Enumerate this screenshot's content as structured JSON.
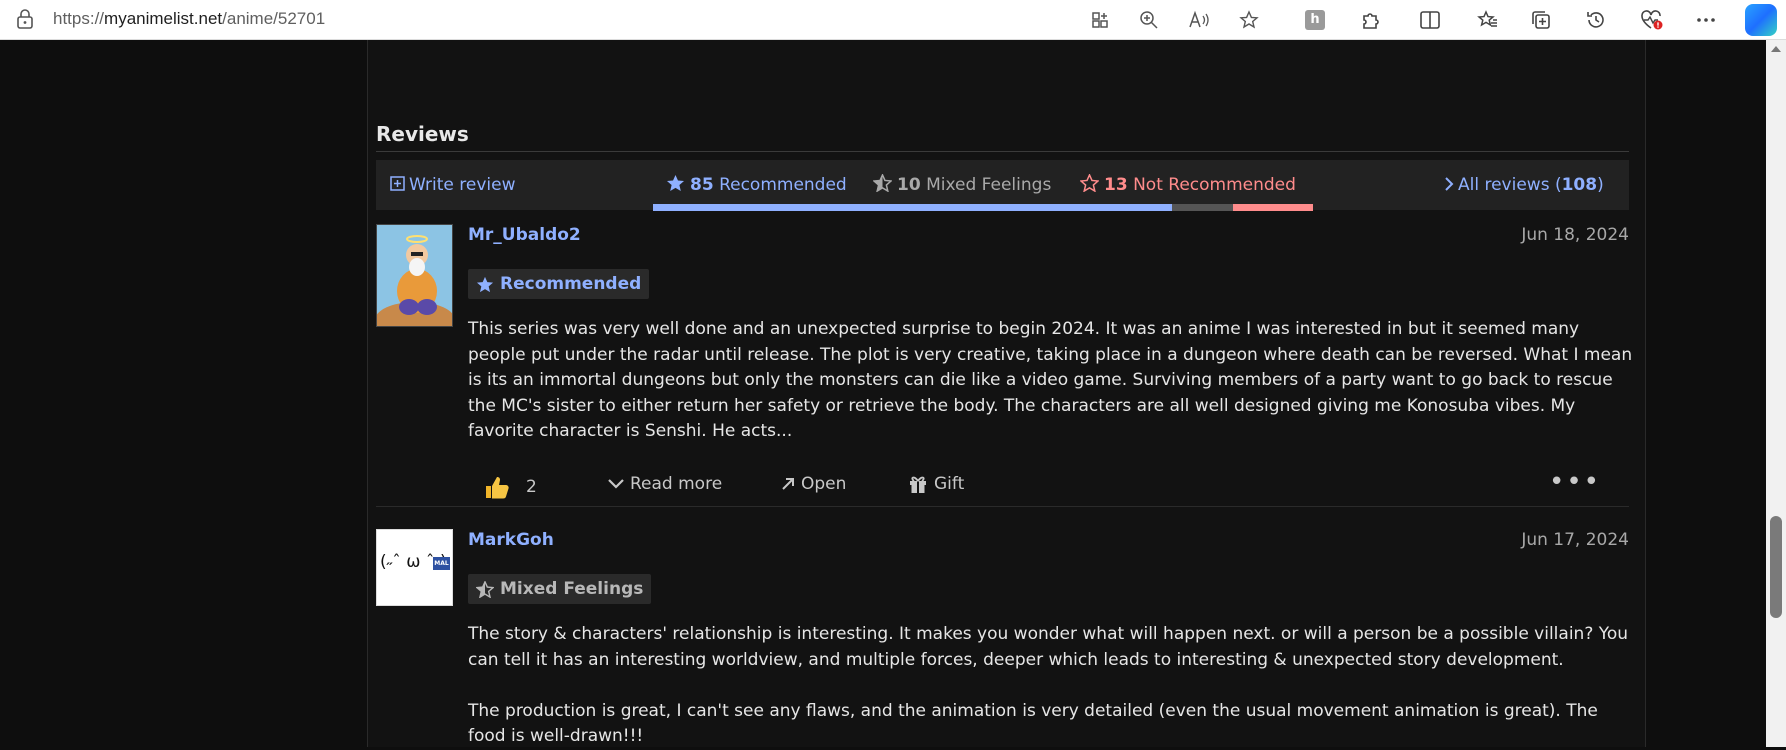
{
  "browser": {
    "url_prefix": "https://",
    "url_host": "myanimelist.net",
    "url_path": "/anime/52701"
  },
  "reviews_section": {
    "title": "Reviews",
    "write_review_label": "Write review",
    "recommended_count": "85",
    "recommended_label": "Recommended",
    "mixed_count": "10",
    "mixed_label": "Mixed Feelings",
    "not_recommended_count": "13",
    "not_recommended_label": "Not Recommended",
    "all_reviews_label": "All reviews (",
    "all_reviews_count": "108",
    "all_reviews_close": ")",
    "colors": {
      "recommended": "#8fb0ff",
      "mixed": "#555555",
      "not_recommended": "#ff8c8c"
    }
  },
  "reviews": [
    {
      "username": "Mr_Ubaldo2",
      "date": "Jun 18, 2024",
      "tag": "Recommended",
      "paragraphs": [
        "This series was very well done and an unexpected surprise to begin 2024. It was an anime I was interested in but it seemed many people put under the radar until release. The plot is very creative, taking place in a dungeon where death can be reversed. What I mean is its an immortal dungeons but only the monsters can die like a video game. Surviving members of a party want to go back to rescue the MC's sister to either return her safety or retrieve the body. The characters are all well designed giving me Konosuba vibes. My favorite character is Senshi. He acts..."
      ],
      "likes": "2",
      "read_more": "Read more",
      "open": "Open",
      "gift": "Gift"
    },
    {
      "username": "MarkGoh",
      "date": "Jun 17, 2024",
      "tag": "Mixed Feelings",
      "avatar_text": "(˶ˆ ω ˆ˶)",
      "avatar_badge": "MAL",
      "paragraphs": [
        "The story & characters' relationship is interesting. It makes you wonder what will happen next. or will a person be a possible villain? You can tell it has an interesting worldview, and multiple forces, deeper which leads to interesting & unexpected story development.",
        "The production is great, I can't see any flaws, and the animation is very detailed (even the usual movement animation is great). The food is well-drawn!!!"
      ]
    }
  ]
}
